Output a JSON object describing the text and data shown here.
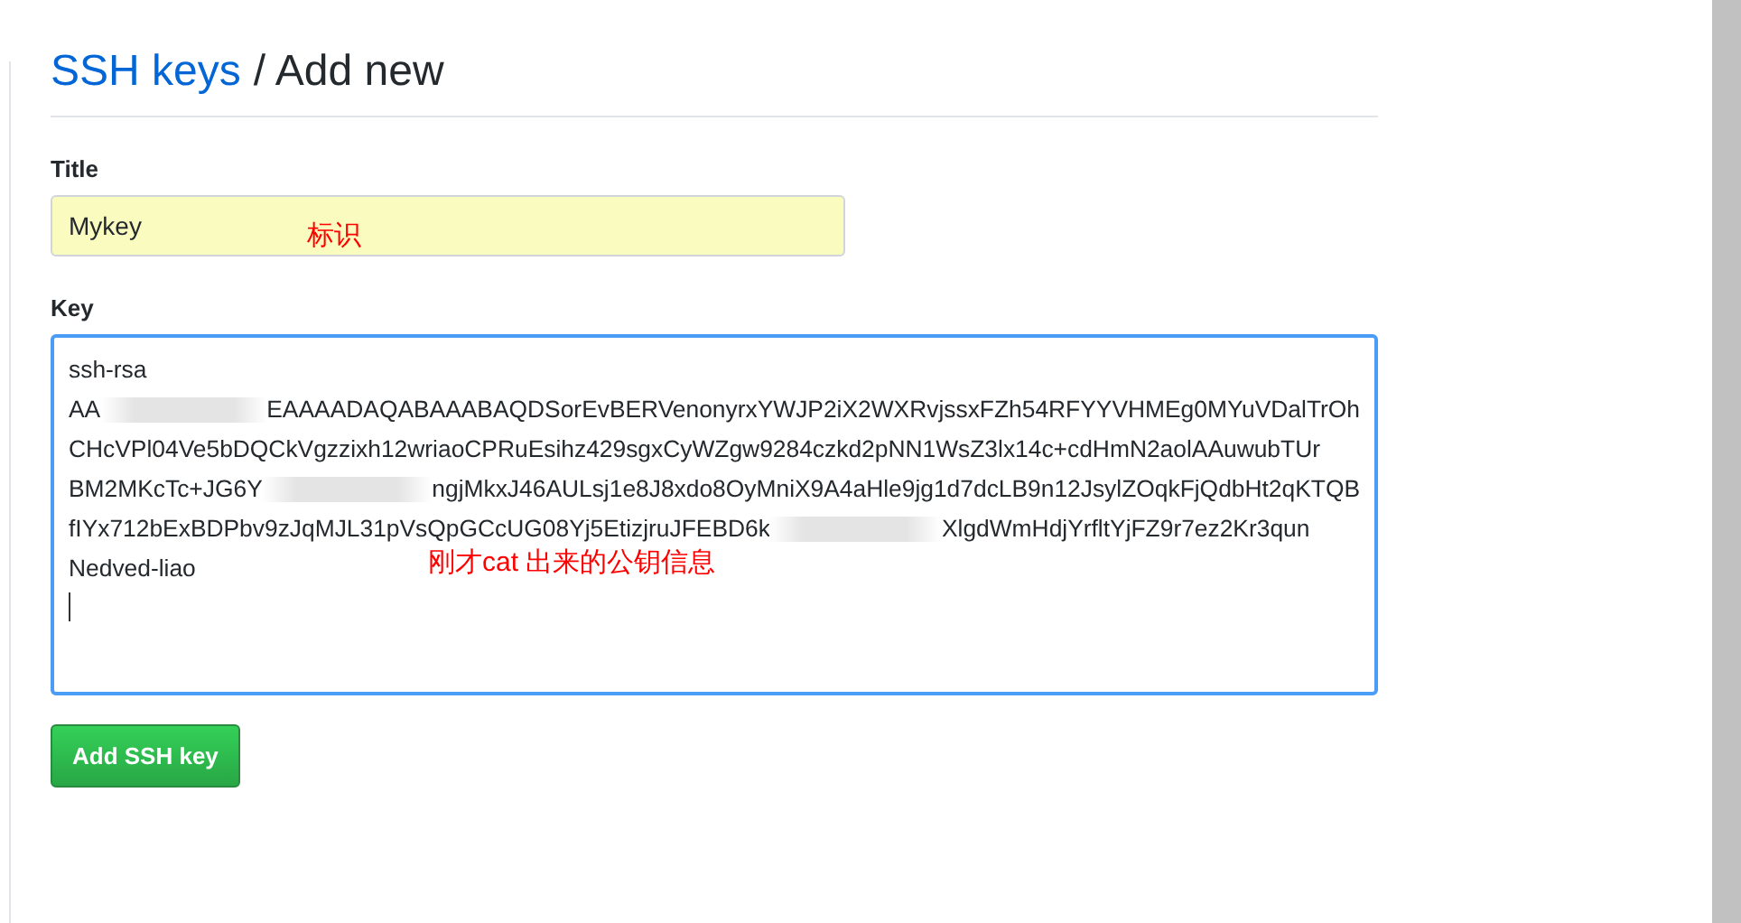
{
  "heading": {
    "link": "SSH keys",
    "rest": "/ Add new"
  },
  "title_field": {
    "label": "Title",
    "value": "Mykey",
    "annotation": "标识"
  },
  "key_field": {
    "label": "Key",
    "annotation": "刚才cat 出来的公钥信息",
    "lines": [
      [
        {
          "kind": "text",
          "text": "ssh-rsa"
        }
      ],
      [
        {
          "kind": "text",
          "text": "AA"
        },
        {
          "kind": "redacted"
        },
        {
          "kind": "text",
          "text": "EAAAADAQABAAABAQDSorEvBERVenonyrxYWJP2iX2WXRvjssxFZh54RFYYVHMEg0MYuVDalTrOh"
        }
      ],
      [
        {
          "kind": "text",
          "text": "CHcVPl04Ve5bDQCkVgzzixh12wriaoCPRuEsihz429sgxCyWZgw9284czkd2pNN1WsZ3lx14c+cdHmN2aolAAuwubTUr"
        }
      ],
      [
        {
          "kind": "text",
          "text": "BM2MKcTc+JG6Y"
        },
        {
          "kind": "redacted"
        },
        {
          "kind": "text",
          "text": "ngjMkxJ46AULsj1e8J8xdo8OyMniX9A4aHle9jg1d7dcLB9n12JsylZOqkFjQdbHt2qKTQB"
        }
      ],
      [
        {
          "kind": "text",
          "text": "fIYx712bExBDPbv9zJqMJL31pVsQpGCcUG08Yj5EtizjruJFEBD6k"
        },
        {
          "kind": "redacted"
        },
        {
          "kind": "text",
          "text": "XlgdWmHdjYrfltYjFZ9r7ez2Kr3qun"
        }
      ],
      [
        {
          "kind": "text",
          "text": "Nedved-liao"
        }
      ]
    ]
  },
  "submit": {
    "label": "Add SSH key"
  }
}
